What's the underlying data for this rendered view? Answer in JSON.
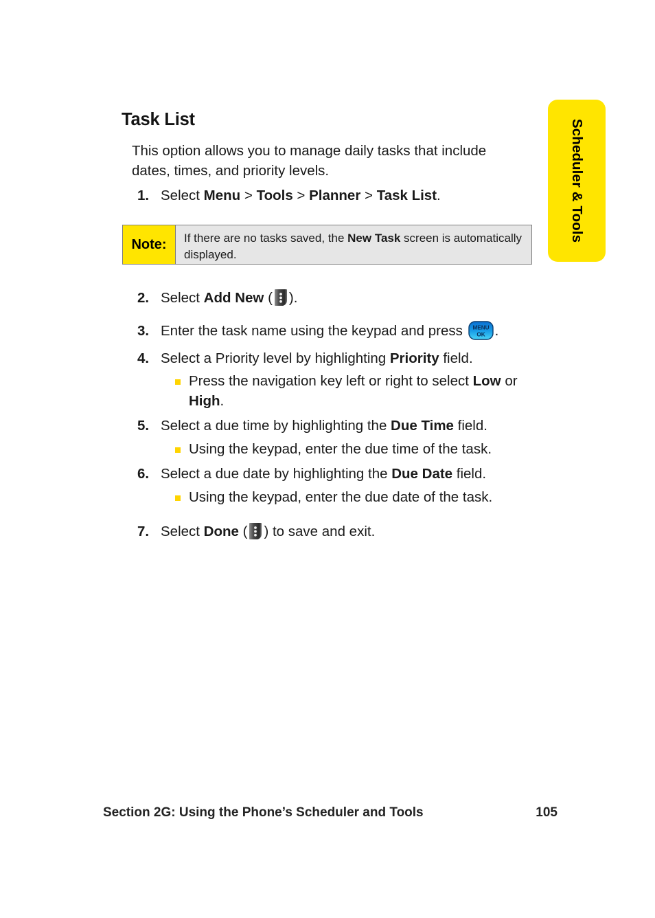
{
  "side_tab": {
    "label": "Scheduler & Tools",
    "bg_color": "#ffe500",
    "text_color": "#000000"
  },
  "page": {
    "heading": "Task List",
    "intro": "This option allows you to manage daily tasks that include dates, times, and priority levels."
  },
  "note": {
    "label": "Note:",
    "text_before": "If there are no tasks saved, the ",
    "text_bold": "New Task",
    "text_after": " screen is automatically displayed.",
    "label_bg": "#ffe500",
    "body_bg": "#e6e6e6",
    "border_color": "#7d7d7d"
  },
  "steps": [
    {
      "num": "1.",
      "parts": [
        {
          "t": "Select ",
          "b": false
        },
        {
          "t": "Menu",
          "b": true
        },
        {
          "t": " > ",
          "b": false
        },
        {
          "t": "Tools",
          "b": true
        },
        {
          "t": " > ",
          "b": false
        },
        {
          "t": "Planner",
          "b": true
        },
        {
          "t": " > ",
          "b": false
        },
        {
          "t": "Task List",
          "b": true
        },
        {
          "t": ".",
          "b": false
        }
      ]
    },
    {
      "num": "2.",
      "parts": [
        {
          "t": "Select ",
          "b": false
        },
        {
          "t": "Add New",
          "b": true
        },
        {
          "t": " (",
          "b": false
        },
        {
          "icon": "softkey-icon"
        },
        {
          "t": ").",
          "b": false
        }
      ]
    },
    {
      "num": "3.",
      "parts": [
        {
          "t": "Enter the task name using the keypad and press ",
          "b": false
        },
        {
          "icon": "menu-ok-key-icon"
        },
        {
          "t": ".",
          "b": false
        }
      ]
    },
    {
      "num": "4.",
      "parts": [
        {
          "t": "Select a Priority level by highlighting ",
          "b": false
        },
        {
          "t": "Priority",
          "b": true
        },
        {
          "t": " field.",
          "b": false
        }
      ]
    },
    {
      "num": "5.",
      "parts": [
        {
          "t": "Select a due time by highlighting the ",
          "b": false
        },
        {
          "t": "Due Time",
          "b": true
        },
        {
          "t": " field.",
          "b": false
        }
      ]
    },
    {
      "num": "6.",
      "parts": [
        {
          "t": "Select a due date by highlighting the ",
          "b": false
        },
        {
          "t": "Due Date",
          "b": true
        },
        {
          "t": " field.",
          "b": false
        }
      ]
    },
    {
      "num": "7.",
      "parts": [
        {
          "t": "Select ",
          "b": false
        },
        {
          "t": "Done",
          "b": true
        },
        {
          "t": " (",
          "b": false
        },
        {
          "icon": "softkey-icon"
        },
        {
          "t": ") to save and exit.",
          "b": false
        }
      ]
    }
  ],
  "sub_bullets": [
    {
      "after_step": "4",
      "parts": [
        {
          "t": "Press the navigation key left or right to select ",
          "b": false
        },
        {
          "t": "Low",
          "b": true
        },
        {
          "t": " or ",
          "b": false
        },
        {
          "t": "High",
          "b": true
        },
        {
          "t": ".",
          "b": false
        }
      ]
    },
    {
      "after_step": "5",
      "parts": [
        {
          "t": "Using the keypad, enter the due time of the task.",
          "b": false
        }
      ]
    },
    {
      "after_step": "6",
      "parts": [
        {
          "t": "Using the keypad, enter the due date of the task.",
          "b": false
        }
      ]
    }
  ],
  "bullet_marker_color": "#ffd400",
  "footer": {
    "section": "Section 2G: Using the Phone’s Scheduler and Tools",
    "page_number": "105"
  },
  "icons": {
    "softkey_icon_name": "softkey-menu-icon",
    "menu_ok_icon_name": "menu-ok-key-icon",
    "menu_ok_top_label": "MENU",
    "menu_ok_bottom_label": "OK",
    "menu_ok_color": "#1a9fe8"
  }
}
